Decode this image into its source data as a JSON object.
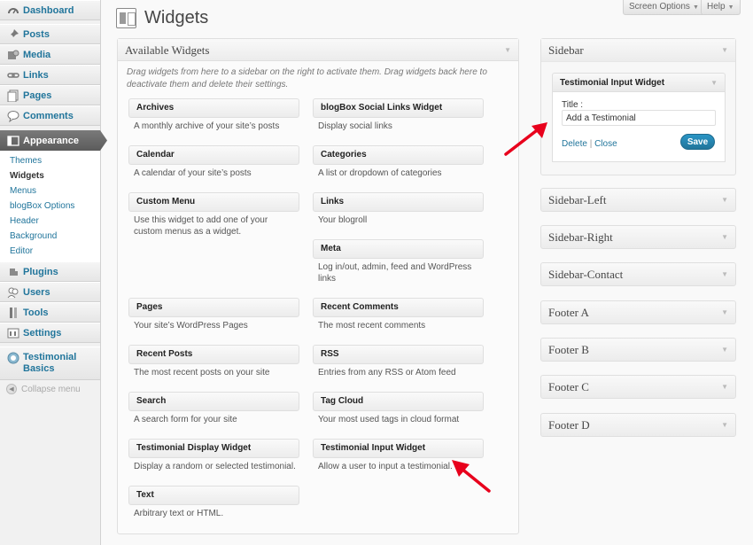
{
  "menu": {
    "dashboard": "Dashboard",
    "posts": "Posts",
    "media": "Media",
    "links": "Links",
    "pages": "Pages",
    "comments": "Comments",
    "appearance": "Appearance",
    "submenu": [
      "Themes",
      "Widgets",
      "Menus",
      "blogBox Options",
      "Header",
      "Background",
      "Editor"
    ],
    "plugins": "Plugins",
    "users": "Users",
    "tools": "Tools",
    "settings": "Settings",
    "testimonial_line1": "Testimonial",
    "testimonial_line2": "Basics",
    "collapse": "Collapse menu"
  },
  "header": {
    "title": "Widgets",
    "screen_options": "Screen Options",
    "help": "Help"
  },
  "available": {
    "title": "Available Widgets",
    "description": "Drag widgets from here to a sidebar on the right to activate them. Drag widgets back here to deactivate them and delete their settings.",
    "widgets": [
      {
        "title": "Archives",
        "desc": "A monthly archive of your site’s posts"
      },
      {
        "title": "blogBox Social Links Widget",
        "desc": "Display social links"
      },
      {
        "title": "Calendar",
        "desc": "A calendar of your site’s posts"
      },
      {
        "title": "Categories",
        "desc": "A list or dropdown of categories"
      },
      {
        "title": "Custom Menu",
        "desc": "Use this widget to add one of your custom menus as a widget."
      },
      {
        "title": "Links",
        "desc": "Your blogroll"
      },
      {
        "title": "Meta",
        "desc": "Log in/out, admin, feed and WordPress links"
      },
      {
        "title": "Pages",
        "desc": "Your site’s WordPress Pages"
      },
      {
        "title": "Recent Comments",
        "desc": "The most recent comments"
      },
      {
        "title": "Recent Posts",
        "desc": "The most recent posts on your site"
      },
      {
        "title": "RSS",
        "desc": "Entries from any RSS or Atom feed"
      },
      {
        "title": "Search",
        "desc": "A search form for your site"
      },
      {
        "title": "Tag Cloud",
        "desc": "Your most used tags in cloud format"
      },
      {
        "title": "Testimonial Display Widget",
        "desc": "Display a random or selected testimonial."
      },
      {
        "title": "Testimonial Input Widget",
        "desc": "Allow a user to input a testimonial."
      },
      {
        "title": "Text",
        "desc": "Arbitrary text or HTML."
      }
    ]
  },
  "sidebar": {
    "title": "Sidebar",
    "widget": {
      "title": "Testimonial Input Widget",
      "field_label": "Title :",
      "field_value": "Add a Testimonial",
      "delete": "Delete",
      "separator": "|",
      "close": "Close",
      "save": "Save"
    }
  },
  "sidebars": [
    "Sidebar-Left",
    "Sidebar-Right",
    "Sidebar-Contact",
    "Footer A",
    "Footer B",
    "Footer C",
    "Footer D"
  ],
  "colors": {
    "link": "#21759b",
    "annotation_arrow": "#e8001c"
  }
}
